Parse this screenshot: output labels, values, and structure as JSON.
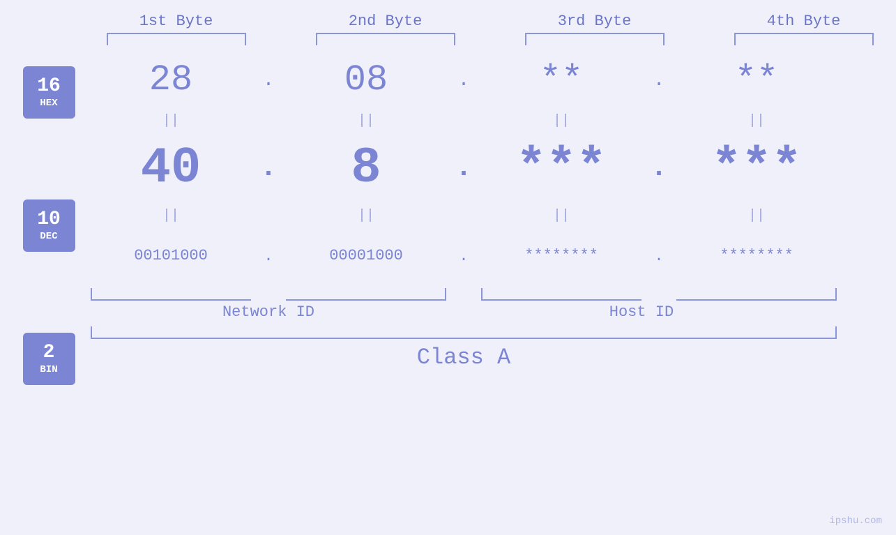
{
  "header": {
    "bytes": [
      "1st Byte",
      "2nd Byte",
      "3rd Byte",
      "4th Byte"
    ]
  },
  "bases": [
    {
      "number": "16",
      "label": "HEX"
    },
    {
      "number": "10",
      "label": "DEC"
    },
    {
      "number": "2",
      "label": "BIN"
    }
  ],
  "rows": {
    "hex": {
      "values": [
        "28",
        "08",
        "**",
        "**"
      ],
      "dot": "."
    },
    "dec": {
      "values": [
        "40",
        "8",
        "***",
        "***"
      ],
      "dot": "."
    },
    "bin": {
      "values": [
        "00101000",
        "00001000",
        "********",
        "********"
      ],
      "dot": "."
    }
  },
  "labels": {
    "network_id": "Network ID",
    "host_id": "Host ID",
    "class": "Class A"
  },
  "watermark": "ipshu.com"
}
